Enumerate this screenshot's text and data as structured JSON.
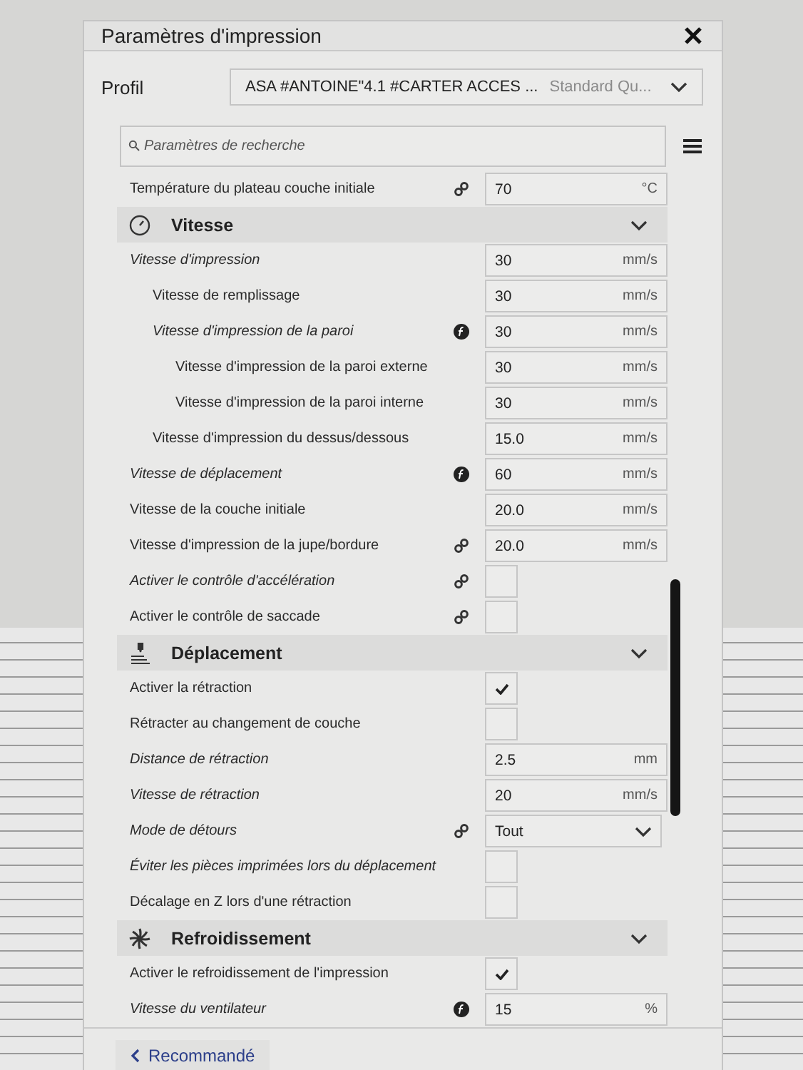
{
  "window": {
    "title": "Paramètres d'impression"
  },
  "profile": {
    "label": "Profil",
    "value": "ASA #ANTOINE\"4.1 #CARTER ACCES ...",
    "hint": "Standard Qu..."
  },
  "search": {
    "placeholder": "Paramètres de recherche"
  },
  "settings": [
    {
      "kind": "number",
      "label": "Température du plateau couche initiale",
      "overridden": false,
      "linked": true,
      "value": "70",
      "unit": "°C"
    },
    {
      "kind": "header",
      "label": "Vitesse",
      "expanded": true
    },
    {
      "kind": "number",
      "label": "Vitesse d'impression",
      "overridden": true,
      "value": "30",
      "unit": "mm/s",
      "children": [
        {
          "kind": "number",
          "label": "Vitesse de remplissage",
          "overridden": false,
          "value": "30",
          "unit": "mm/s"
        },
        {
          "kind": "number",
          "label": "Vitesse d'impression de la paroi",
          "overridden": true,
          "formula": true,
          "value": "30",
          "unit": "mm/s",
          "children": [
            {
              "kind": "number",
              "label": "Vitesse d'impression de la paroi externe",
              "overridden": false,
              "value": "30",
              "unit": "mm/s"
            },
            {
              "kind": "number",
              "label": "Vitesse d'impression de la paroi interne",
              "overridden": false,
              "value": "30",
              "unit": "mm/s"
            }
          ]
        },
        {
          "kind": "number",
          "label": "Vitesse d'impression du dessus/dessous",
          "overridden": false,
          "value": "15.0",
          "unit": "mm/s"
        }
      ]
    },
    {
      "kind": "number",
      "label": "Vitesse de déplacement",
      "overridden": true,
      "formula": true,
      "value": "60",
      "unit": "mm/s"
    },
    {
      "kind": "number",
      "label": "Vitesse de la couche initiale",
      "overridden": false,
      "value": "20.0",
      "unit": "mm/s"
    },
    {
      "kind": "number",
      "label": "Vitesse d'impression de la jupe/bordure",
      "overridden": false,
      "linked": true,
      "value": "20.0",
      "unit": "mm/s"
    },
    {
      "kind": "checkbox",
      "label": "Activer le contrôle d'accélération",
      "overridden": true,
      "linked": true,
      "checked": false
    },
    {
      "kind": "checkbox",
      "label": "Activer le contrôle de saccade",
      "overridden": false,
      "linked": true,
      "checked": false
    },
    {
      "kind": "header",
      "label": "Déplacement",
      "expanded": true
    },
    {
      "kind": "checkbox",
      "label": "Activer la rétraction",
      "overridden": false,
      "checked": true
    },
    {
      "kind": "checkbox",
      "label": "Rétracter au changement de couche",
      "overridden": false,
      "checked": false
    },
    {
      "kind": "number",
      "label": "Distance de rétraction",
      "overridden": true,
      "value": "2.5",
      "unit": "mm"
    },
    {
      "kind": "number",
      "label": "Vitesse de rétraction",
      "overridden": true,
      "value": "20",
      "unit": "mm/s"
    },
    {
      "kind": "select",
      "label": "Mode de détours",
      "overridden": true,
      "linked": true,
      "value": "Tout"
    },
    {
      "kind": "checkbox",
      "label": "Éviter les pièces imprimées lors du déplacement",
      "overridden": true,
      "checked": false
    },
    {
      "kind": "checkbox",
      "label": "Décalage en Z lors d'une rétraction",
      "overridden": false,
      "checked": false
    },
    {
      "kind": "header",
      "label": "Refroidissement",
      "expanded": true
    },
    {
      "kind": "checkbox",
      "label": "Activer le refroidissement de l'impression",
      "overridden": false,
      "checked": true
    },
    {
      "kind": "number",
      "label": "Vitesse du ventilateur",
      "overridden": true,
      "formula": true,
      "value": "15",
      "unit": "%"
    }
  ],
  "footer": {
    "button": "Recommandé"
  }
}
